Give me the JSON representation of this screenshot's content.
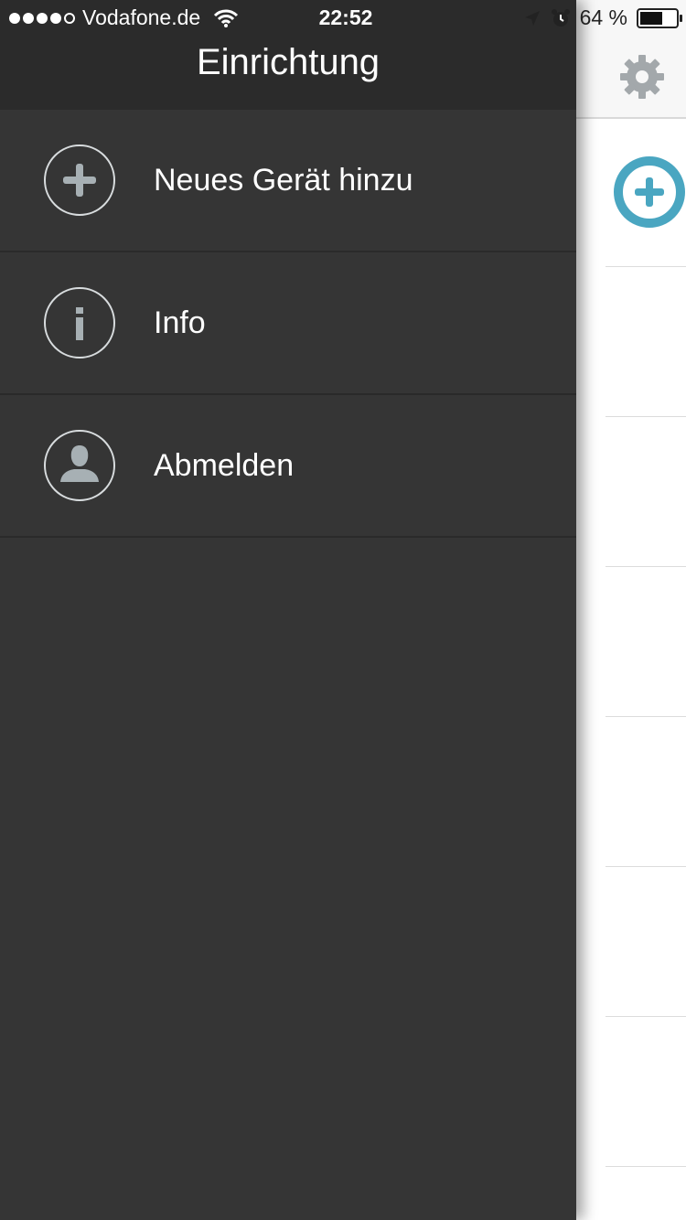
{
  "status_bar": {
    "carrier": "Vodafone.de",
    "time": "22:52",
    "battery_percent": "64 %",
    "battery_level": 0.64
  },
  "drawer": {
    "title": "Einrichtung",
    "items": [
      {
        "label": "Neues Gerät hinzu",
        "icon": "plus-circle-icon"
      },
      {
        "label": "Info",
        "icon": "info-circle-icon"
      },
      {
        "label": "Abmelden",
        "icon": "user-circle-icon"
      }
    ]
  },
  "main": {
    "settings_icon": "gear-icon",
    "add_icon": "add-circle-icon",
    "accent_color": "#4aa6c1"
  },
  "colors": {
    "drawer_bg": "#353535",
    "drawer_header_bg": "#2b2b2b",
    "icon_gray": "#a7b0b4"
  }
}
